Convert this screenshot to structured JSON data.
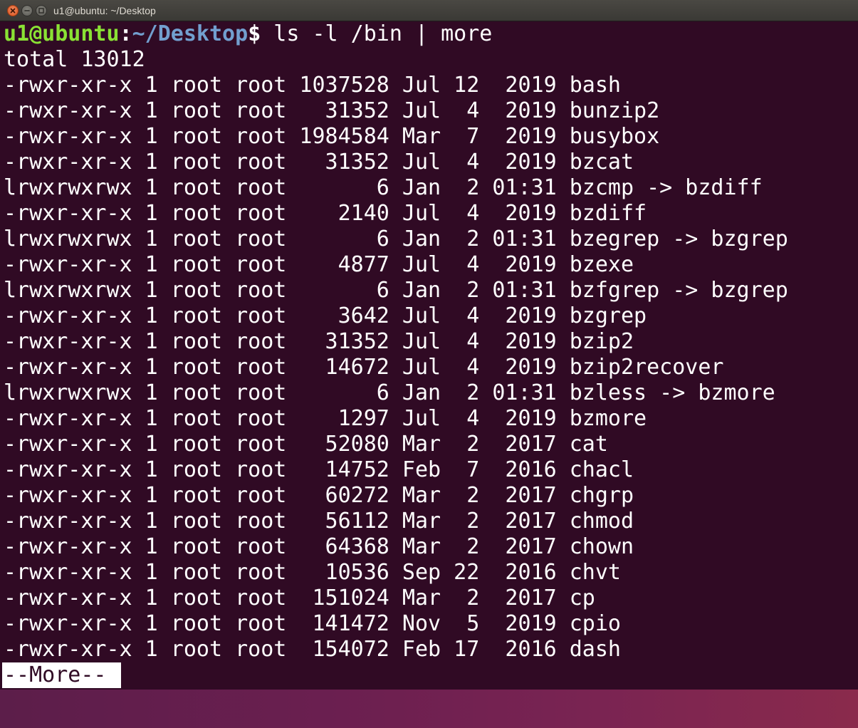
{
  "window": {
    "title": "u1@ubuntu: ~/Desktop"
  },
  "prompt": {
    "user_host": "u1@ubuntu",
    "separator": ":",
    "path": "~/Desktop",
    "symbol": "$",
    "command": " ls -l /bin | more"
  },
  "total_line": "total 13012",
  "rows": [
    "-rwxr-xr-x 1 root root 1037528 Jul 12  2019 bash",
    "-rwxr-xr-x 1 root root   31352 Jul  4  2019 bunzip2",
    "-rwxr-xr-x 1 root root 1984584 Mar  7  2019 busybox",
    "-rwxr-xr-x 1 root root   31352 Jul  4  2019 bzcat",
    "lrwxrwxrwx 1 root root       6 Jan  2 01:31 bzcmp -> bzdiff",
    "-rwxr-xr-x 1 root root    2140 Jul  4  2019 bzdiff",
    "lrwxrwxrwx 1 root root       6 Jan  2 01:31 bzegrep -> bzgrep",
    "-rwxr-xr-x 1 root root    4877 Jul  4  2019 bzexe",
    "lrwxrwxrwx 1 root root       6 Jan  2 01:31 bzfgrep -> bzgrep",
    "-rwxr-xr-x 1 root root    3642 Jul  4  2019 bzgrep",
    "-rwxr-xr-x 1 root root   31352 Jul  4  2019 bzip2",
    "-rwxr-xr-x 1 root root   14672 Jul  4  2019 bzip2recover",
    "lrwxrwxrwx 1 root root       6 Jan  2 01:31 bzless -> bzmore",
    "-rwxr-xr-x 1 root root    1297 Jul  4  2019 bzmore",
    "-rwxr-xr-x 1 root root   52080 Mar  2  2017 cat",
    "-rwxr-xr-x 1 root root   14752 Feb  7  2016 chacl",
    "-rwxr-xr-x 1 root root   60272 Mar  2  2017 chgrp",
    "-rwxr-xr-x 1 root root   56112 Mar  2  2017 chmod",
    "-rwxr-xr-x 1 root root   64368 Mar  2  2017 chown",
    "-rwxr-xr-x 1 root root   10536 Sep 22  2016 chvt",
    "-rwxr-xr-x 1 root root  151024 Mar  2  2017 cp",
    "-rwxr-xr-x 1 root root  141472 Nov  5  2019 cpio",
    "-rwxr-xr-x 1 root root  154072 Feb 17  2016 dash"
  ],
  "more_indicator": "--More--",
  "colors": {
    "terminal_bg": "#300a24",
    "prompt_user": "#8ae234",
    "prompt_path": "#729fcf",
    "text": "#ffffff"
  },
  "icons": {
    "close": "close-icon",
    "minimize": "minimize-icon",
    "maximize": "maximize-icon"
  }
}
